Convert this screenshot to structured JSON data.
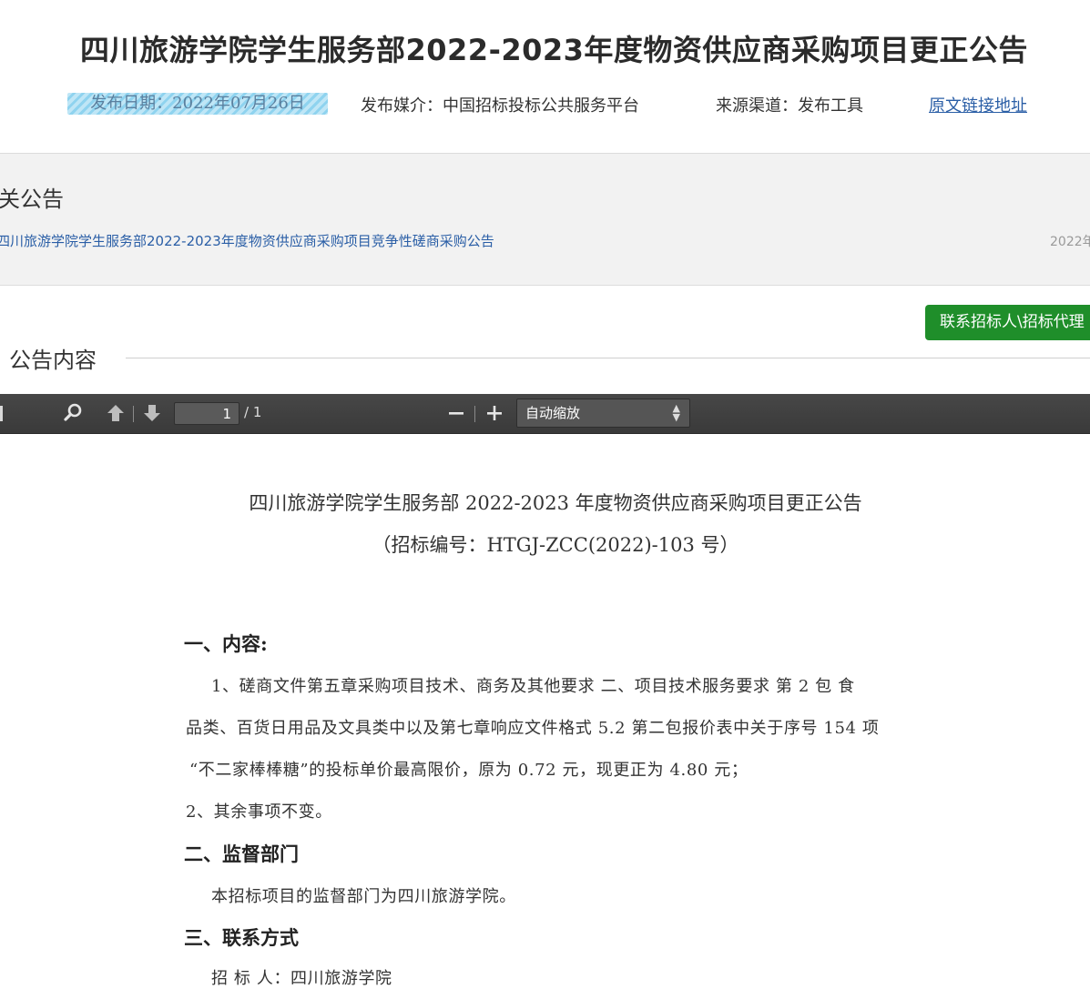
{
  "header": {
    "title": "四川旅游学院学生服务部2022-2023年度物资供应商采购项目更正公告",
    "publish_date": "发布日期：2022年07月26日",
    "media": "发布媒介：中国招标投标公共服务平台",
    "source": "来源渠道：发布工具",
    "source_link": "原文链接地址"
  },
  "related": {
    "title": "关公告",
    "items": [
      {
        "label": "四川旅游学院学生服务部2022-2023年度物资供应商采购项目竞争性磋商采购公告",
        "date": "2022年"
      }
    ]
  },
  "contact_button": "联系招标人\\招标代理",
  "content_heading": "公告内容",
  "pdf_toolbar": {
    "page_current": "1",
    "page_total": "/ 1",
    "zoom_label": "自动缩放",
    "icons": [
      "sidebar-toggle-icon",
      "search-icon",
      "previous-page-icon",
      "next-page-icon",
      "zoom-out-icon",
      "zoom-in-icon",
      "select-arrows-icon"
    ]
  },
  "document": {
    "title": "四川旅游学院学生服务部 2022-2023 年度物资供应商采购项目更正公告",
    "code": "（招标编号：HTGJ-ZCC(2022)-103 号）",
    "sections": [
      {
        "heading": "一、内容:",
        "lines": [
          "1、磋商文件第五章采购项目技术、商务及其他要求 二、项目技术服务要求 第 2 包 食",
          "品类、百货日用品及文具类中以及第七章响应文件格式 5.2 第二包报价表中关于序号 154 项",
          "“不二家棒棒糖”的投标单价最高限价，原为 0.72 元，现更正为 4.80 元；",
          "2、其余事项不变。"
        ]
      },
      {
        "heading": "二、监督部门",
        "lines": [
          "本招标项目的监督部门为四川旅游学院。"
        ]
      },
      {
        "heading": "三、联系方式",
        "lines": [
          "招 标 人：四川旅游学院"
        ]
      }
    ]
  }
}
